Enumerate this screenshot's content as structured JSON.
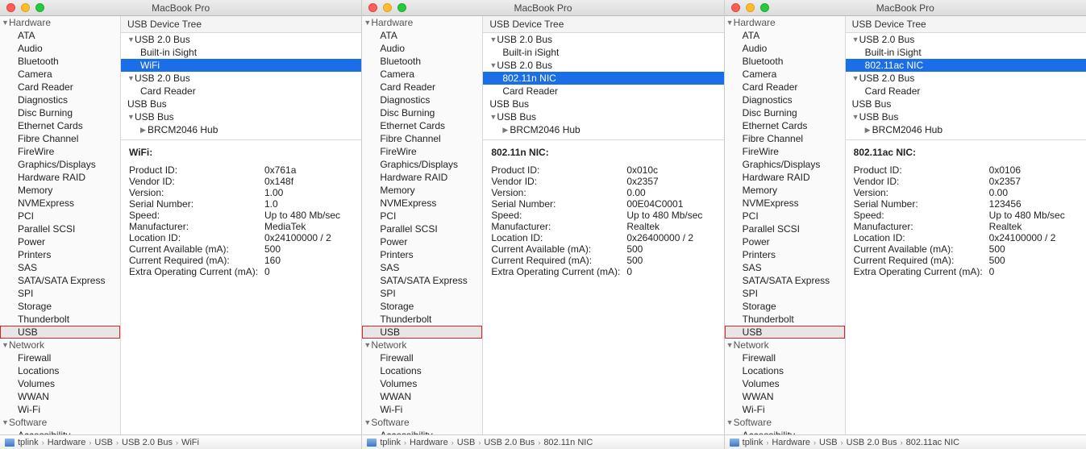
{
  "windows": [
    {
      "title": "MacBook Pro",
      "sidebar": {
        "groups": [
          {
            "label": "Hardware",
            "items": [
              "ATA",
              "Audio",
              "Bluetooth",
              "Camera",
              "Card Reader",
              "Diagnostics",
              "Disc Burning",
              "Ethernet Cards",
              "Fibre Channel",
              "FireWire",
              "Graphics/Displays",
              "Hardware RAID",
              "Memory",
              "NVMExpress",
              "PCI",
              "Parallel SCSI",
              "Power",
              "Printers",
              "SAS",
              "SATA/SATA Express",
              "SPI",
              "Storage",
              "Thunderbolt",
              "USB"
            ],
            "selected": "USB",
            "boxed": "USB"
          },
          {
            "label": "Network",
            "items": [
              "Firewall",
              "Locations",
              "Volumes",
              "WWAN",
              "Wi-Fi"
            ]
          },
          {
            "label": "Software",
            "items": [
              "Accessibility"
            ]
          }
        ]
      },
      "list_header": "USB Device Tree",
      "tree": [
        {
          "label": "USB 2.0 Bus",
          "level": 0,
          "arrow": true
        },
        {
          "label": "Built-in iSight",
          "level": 1
        },
        {
          "label": "WiFi",
          "level": 1,
          "selected": true
        },
        {
          "label": "USB 2.0 Bus",
          "level": 0,
          "arrow": true
        },
        {
          "label": "Card Reader",
          "level": 1
        },
        {
          "label": "USB Bus",
          "level": 0
        },
        {
          "label": "USB Bus",
          "level": 0,
          "arrow": true
        },
        {
          "label": "BRCM2046 Hub",
          "level": 1,
          "arrow": true,
          "collapsed": true
        }
      ],
      "detail": {
        "title": "WiFi:",
        "rows": [
          [
            "Product ID:",
            "0x761a"
          ],
          [
            "Vendor ID:",
            "0x148f"
          ],
          [
            "Version:",
            "1.00"
          ],
          [
            "Serial Number:",
            "1.0"
          ],
          [
            "Speed:",
            "Up to 480 Mb/sec"
          ],
          [
            "Manufacturer:",
            "MediaTek"
          ],
          [
            "Location ID:",
            "0x24100000 / 2"
          ],
          [
            "Current Available (mA):",
            "500"
          ],
          [
            "Current Required (mA):",
            "160"
          ],
          [
            "Extra Operating Current (mA):",
            "0"
          ]
        ]
      },
      "breadcrumb": [
        "tplink",
        "Hardware",
        "USB",
        "USB 2.0 Bus",
        "WiFi"
      ]
    },
    {
      "title": "MacBook Pro",
      "sidebar": {
        "groups": [
          {
            "label": "Hardware",
            "items": [
              "ATA",
              "Audio",
              "Bluetooth",
              "Camera",
              "Card Reader",
              "Diagnostics",
              "Disc Burning",
              "Ethernet Cards",
              "Fibre Channel",
              "FireWire",
              "Graphics/Displays",
              "Hardware RAID",
              "Memory",
              "NVMExpress",
              "PCI",
              "Parallel SCSI",
              "Power",
              "Printers",
              "SAS",
              "SATA/SATA Express",
              "SPI",
              "Storage",
              "Thunderbolt",
              "USB"
            ],
            "selected": "USB",
            "boxed": "USB"
          },
          {
            "label": "Network",
            "items": [
              "Firewall",
              "Locations",
              "Volumes",
              "WWAN",
              "Wi-Fi"
            ]
          },
          {
            "label": "Software",
            "items": [
              "Accessibility"
            ]
          }
        ]
      },
      "list_header": "USB Device Tree",
      "tree": [
        {
          "label": "USB 2.0 Bus",
          "level": 0,
          "arrow": true
        },
        {
          "label": "Built-in iSight",
          "level": 1
        },
        {
          "label": "USB 2.0 Bus",
          "level": 0,
          "arrow": true
        },
        {
          "label": "802.11n NIC",
          "level": 1,
          "selected": true
        },
        {
          "label": "Card Reader",
          "level": 1
        },
        {
          "label": "USB Bus",
          "level": 0
        },
        {
          "label": "USB Bus",
          "level": 0,
          "arrow": true
        },
        {
          "label": "BRCM2046 Hub",
          "level": 1,
          "arrow": true,
          "collapsed": true
        }
      ],
      "detail": {
        "title": "802.11n NIC:",
        "rows": [
          [
            "Product ID:",
            "0x010c"
          ],
          [
            "Vendor ID:",
            "0x2357"
          ],
          [
            "Version:",
            "0.00"
          ],
          [
            "Serial Number:",
            "00E04C0001"
          ],
          [
            "Speed:",
            "Up to 480 Mb/sec"
          ],
          [
            "Manufacturer:",
            "Realtek"
          ],
          [
            "Location ID:",
            "0x26400000 / 2"
          ],
          [
            "Current Available (mA):",
            "500"
          ],
          [
            "Current Required (mA):",
            "500"
          ],
          [
            "Extra Operating Current (mA):",
            "0"
          ]
        ]
      },
      "breadcrumb": [
        "tplink",
        "Hardware",
        "USB",
        "USB 2.0 Bus",
        "802.11n NIC"
      ]
    },
    {
      "title": "MacBook Pro",
      "sidebar": {
        "groups": [
          {
            "label": "Hardware",
            "items": [
              "ATA",
              "Audio",
              "Bluetooth",
              "Camera",
              "Card Reader",
              "Diagnostics",
              "Disc Burning",
              "Ethernet Cards",
              "Fibre Channel",
              "FireWire",
              "Graphics/Displays",
              "Hardware RAID",
              "Memory",
              "NVMExpress",
              "PCI",
              "Parallel SCSI",
              "Power",
              "Printers",
              "SAS",
              "SATA/SATA Express",
              "SPI",
              "Storage",
              "Thunderbolt",
              "USB"
            ],
            "selected": "USB",
            "boxed": "USB"
          },
          {
            "label": "Network",
            "items": [
              "Firewall",
              "Locations",
              "Volumes",
              "WWAN",
              "Wi-Fi"
            ]
          },
          {
            "label": "Software",
            "items": [
              "Accessibility"
            ]
          }
        ]
      },
      "list_header": "USB Device Tree",
      "tree": [
        {
          "label": "USB 2.0 Bus",
          "level": 0,
          "arrow": true
        },
        {
          "label": "Built-in iSight",
          "level": 1
        },
        {
          "label": "802.11ac NIC",
          "level": 1,
          "selected": true
        },
        {
          "label": "USB 2.0 Bus",
          "level": 0,
          "arrow": true
        },
        {
          "label": "Card Reader",
          "level": 1
        },
        {
          "label": "USB Bus",
          "level": 0
        },
        {
          "label": "USB Bus",
          "level": 0,
          "arrow": true
        },
        {
          "label": "BRCM2046 Hub",
          "level": 1,
          "arrow": true,
          "collapsed": true
        }
      ],
      "detail": {
        "title": "802.11ac NIC:",
        "rows": [
          [
            "Product ID:",
            "0x0106"
          ],
          [
            "Vendor ID:",
            "0x2357"
          ],
          [
            "Version:",
            "0.00"
          ],
          [
            "Serial Number:",
            "123456"
          ],
          [
            "Speed:",
            "Up to 480 Mb/sec"
          ],
          [
            "Manufacturer:",
            "Realtek"
          ],
          [
            "Location ID:",
            "0x24100000 / 2"
          ],
          [
            "Current Available (mA):",
            "500"
          ],
          [
            "Current Required (mA):",
            "500"
          ],
          [
            "Extra Operating Current (mA):",
            "0"
          ]
        ]
      },
      "breadcrumb": [
        "tplink",
        "Hardware",
        "USB",
        "USB 2.0 Bus",
        "802.11ac NIC"
      ]
    }
  ]
}
